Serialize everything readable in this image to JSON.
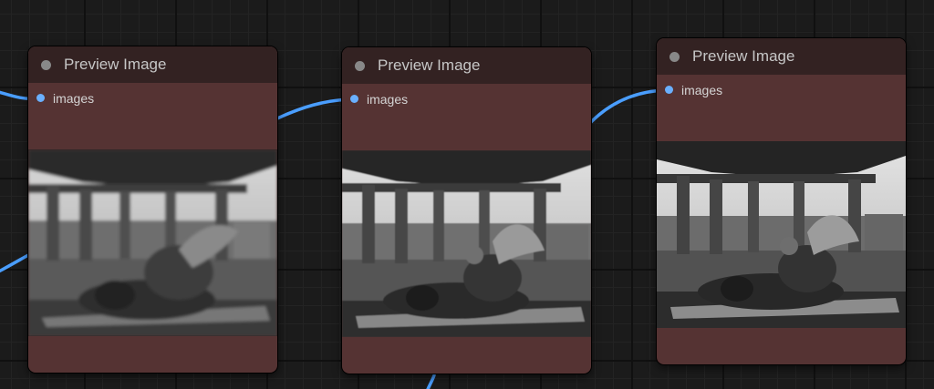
{
  "colors": {
    "canvas": "#1b1b1b",
    "node_body": "#553333",
    "node_title": "#332222",
    "link": "#4a9eff",
    "input_dot": "#6ab0ff"
  },
  "nodes": [
    {
      "title": "Preview Image",
      "input_label": "images",
      "image": "blurry monochrome angel lying on sleeping person under bridge"
    },
    {
      "title": "Preview Image",
      "input_label": "images",
      "image": "monochrome angel resting on sleeping person under bridge"
    },
    {
      "title": "Preview Image",
      "input_label": "images",
      "image": "sharp monochrome angel resting on sleeping person under bridge"
    }
  ]
}
